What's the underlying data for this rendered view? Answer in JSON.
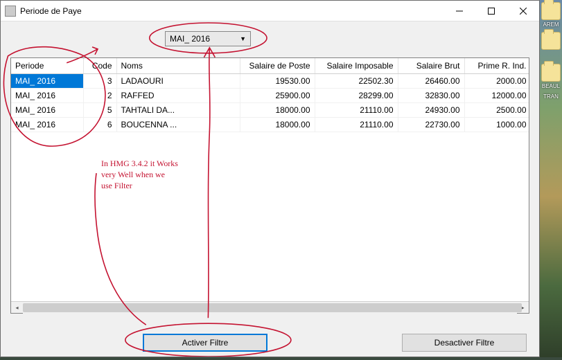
{
  "window": {
    "title": "Periode de Paye"
  },
  "combo": {
    "selected": "MAI_ 2016"
  },
  "grid": {
    "columns": [
      "Periode",
      "Code",
      "Noms",
      "Salaire de Poste",
      "Salaire Imposable",
      "Salaire Brut",
      "Prime R. Ind."
    ],
    "rows": [
      {
        "periode": "MAI_ 2016",
        "code": "3",
        "noms": "LADAOURI",
        "poste": "19530.00",
        "imposable": "22502.30",
        "brut": "26460.00",
        "prime": "2000.00",
        "selected": true
      },
      {
        "periode": "MAI_ 2016",
        "code": "2",
        "noms": "RAFFED",
        "poste": "25900.00",
        "imposable": "28299.00",
        "brut": "32830.00",
        "prime": "12000.00"
      },
      {
        "periode": "MAI_ 2016",
        "code": "5",
        "noms": "TAHTALI         DA...",
        "poste": "18000.00",
        "imposable": "21110.00",
        "brut": "24930.00",
        "prime": "2500.00"
      },
      {
        "periode": "MAI_ 2016",
        "code": "6",
        "noms": "BOUCENNA        ...",
        "poste": "18000.00",
        "imposable": "21110.00",
        "brut": "22730.00",
        "prime": "1000.00"
      }
    ]
  },
  "buttons": {
    "activer": "Activer Filtre",
    "desactiver": "Desactiver Filtre"
  },
  "annotation": {
    "line1": "In HMG 3.4.2  it Works",
    "line2": "very Well when we",
    "line3": "use Filter"
  },
  "desktop_labels": {
    "l1": "AREM",
    "l2": "BEAUL",
    "l3": "TRAN"
  }
}
